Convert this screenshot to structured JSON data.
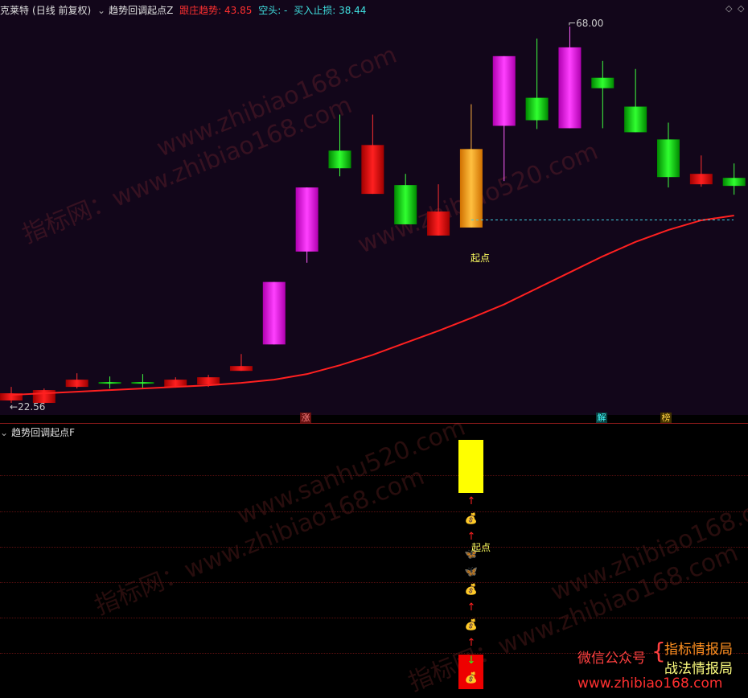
{
  "header": {
    "stock": "克莱特",
    "period": "(日线 前复权)",
    "indicator": "趋势回调起点Z",
    "trend_label": "跟庄趋势: 43.85",
    "bear_label": "空头: -",
    "stop_label": "买入止损: 38.44"
  },
  "price_labels": {
    "high": "68.00",
    "low": "22.56",
    "start": "起点"
  },
  "badges": {
    "zhang": "涨",
    "jie": "解",
    "bang": "榜"
  },
  "lower": {
    "indicator": "趋势回调起点F",
    "start": "起点"
  },
  "promo": {
    "wechat": "微信公众号",
    "brace": "{",
    "line1": "指标情报局",
    "line2": "战法情报局",
    "url": "www.zhibiao168.com"
  },
  "watermarks": [
    "www.zhibiao168.com",
    "www.zhibiao520.com",
    "指标网：www.zhibiao168.com",
    "www.sanhu520.com"
  ],
  "colors": {
    "up_magenta": "#ff00ff",
    "down_green": "#00dd00",
    "red": "#ee0000",
    "orange": "#ffa500",
    "ma": "#ff2020"
  },
  "chart_data": {
    "type": "candlestick",
    "y_range": [
      22.56,
      68.0
    ],
    "candles": [
      {
        "o": 22.2,
        "c": 21.3,
        "h": 23.0,
        "l": 21.0,
        "color": "red"
      },
      {
        "o": 21.0,
        "c": 22.6,
        "h": 22.8,
        "l": 20.8,
        "color": "red"
      },
      {
        "o": 23.0,
        "c": 23.9,
        "h": 24.7,
        "l": 22.8,
        "color": "red"
      },
      {
        "o": 23.6,
        "c": 23.4,
        "h": 24.3,
        "l": 22.8,
        "color": "green"
      },
      {
        "o": 23.6,
        "c": 23.4,
        "h": 24.6,
        "l": 22.8,
        "color": "green"
      },
      {
        "o": 23.0,
        "c": 23.9,
        "h": 24.2,
        "l": 22.9,
        "color": "red"
      },
      {
        "o": 23.3,
        "c": 24.2,
        "h": 24.5,
        "l": 23.0,
        "color": "red"
      },
      {
        "o": 25.0,
        "c": 25.6,
        "h": 27.1,
        "l": 25.0,
        "color": "red"
      },
      {
        "o": 28.3,
        "c": 36.1,
        "h": 36.1,
        "l": 28.3,
        "color": "magenta"
      },
      {
        "o": 39.9,
        "c": 47.9,
        "h": 47.9,
        "l": 38.5,
        "color": "magenta"
      },
      {
        "o": 50.3,
        "c": 52.5,
        "h": 57.0,
        "l": 49.3,
        "color": "green"
      },
      {
        "o": 47.1,
        "c": 53.2,
        "h": 57.0,
        "l": 47.1,
        "color": "red"
      },
      {
        "o": 48.2,
        "c": 43.3,
        "h": 49.6,
        "l": 43.3,
        "color": "green"
      },
      {
        "o": 41.9,
        "c": 44.9,
        "h": 48.3,
        "l": 41.9,
        "color": "red"
      },
      {
        "o": 42.9,
        "c": 52.7,
        "h": 58.3,
        "l": 42.9,
        "color": "orange"
      },
      {
        "o": 55.6,
        "c": 64.3,
        "h": 64.3,
        "l": 48.7,
        "color": "magenta"
      },
      {
        "o": 59.1,
        "c": 56.3,
        "h": 66.5,
        "l": 55.2,
        "color": "green"
      },
      {
        "o": 55.3,
        "c": 65.4,
        "h": 68.0,
        "l": 55.3,
        "color": "magenta"
      },
      {
        "o": 61.6,
        "c": 60.3,
        "h": 63.7,
        "l": 55.3,
        "color": "green"
      },
      {
        "o": 58.0,
        "c": 54.8,
        "h": 62.7,
        "l": 54.8,
        "color": "green"
      },
      {
        "o": 53.9,
        "c": 49.2,
        "h": 56.0,
        "l": 47.9,
        "color": "green"
      },
      {
        "o": 49.6,
        "c": 48.3,
        "h": 51.9,
        "l": 48.0,
        "color": "red"
      },
      {
        "o": 49.1,
        "c": 48.1,
        "h": 50.9,
        "l": 47.0,
        "color": "green"
      }
    ],
    "ma": [
      22.0,
      22.2,
      22.4,
      22.6,
      22.8,
      23.0,
      23.2,
      23.5,
      23.9,
      24.6,
      25.7,
      27.0,
      28.5,
      30.0,
      31.6,
      33.3,
      35.3,
      37.3,
      39.3,
      41.1,
      42.6,
      43.8,
      44.4
    ],
    "stop_line": 43.85,
    "lower_signals": [
      "up-arrow",
      "money",
      "up-arrow",
      "butterfly",
      "butterfly",
      "money",
      "up-arrow",
      "money",
      "up-arrow",
      "down-arrow",
      "money"
    ]
  }
}
